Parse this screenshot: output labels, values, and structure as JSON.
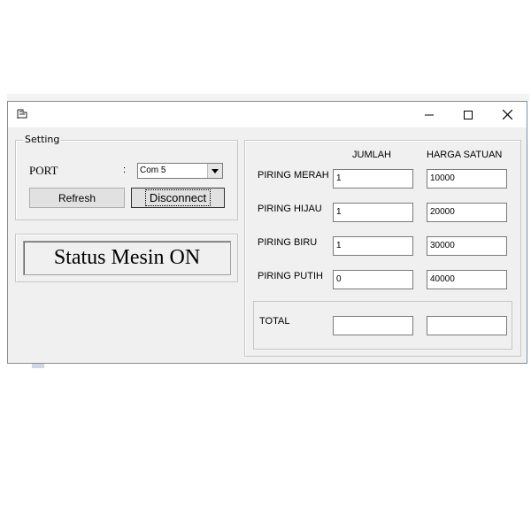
{
  "window": {
    "title": ""
  },
  "titlebar": {
    "minimize_icon": "minimize-icon",
    "maximize_icon": "maximize-icon",
    "close_icon": "close-icon"
  },
  "setting": {
    "group_title": "Setting",
    "port_label": "PORT",
    "colon": ":",
    "port_value": "Com 5",
    "refresh_label": "Refresh",
    "disconnect_label": "Disconnect"
  },
  "status": {
    "text": "Status Mesin ON"
  },
  "orders": {
    "col_jumlah": "JUMLAH",
    "col_harga": "HARGA SATUAN",
    "rows": [
      {
        "label": "PIRING MERAH",
        "jumlah": "1",
        "harga": "10000"
      },
      {
        "label": "PIRING HIJAU",
        "jumlah": "1",
        "harga": "20000"
      },
      {
        "label": "PIRING BIRU",
        "jumlah": "1",
        "harga": "30000"
      },
      {
        "label": "PIRING PUTIH",
        "jumlah": "0",
        "harga": "40000"
      }
    ],
    "total_label": "TOTAL",
    "total_jumlah": "",
    "total_harga": ""
  }
}
